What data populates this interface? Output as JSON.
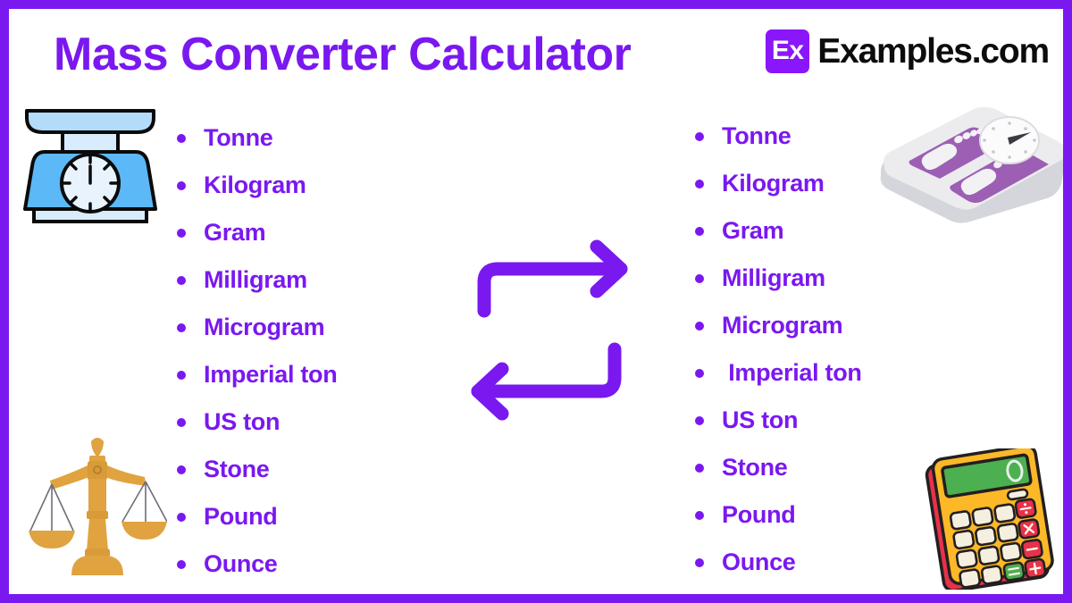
{
  "border_color": "#7a18f0",
  "background_color": "#ffffff",
  "accent_color": "#7a18f0",
  "header": {
    "title": "Mass Converter Calculator",
    "title_color": "#7a18f0",
    "brand": {
      "mark_text": "Ex",
      "mark_color": "#8a16fb",
      "name": "Examples.com",
      "name_color": "#0c0c0c"
    }
  },
  "left_column": {
    "items": [
      {
        "label": "Tonne"
      },
      {
        "label": "Kilogram"
      },
      {
        "label": "Gram"
      },
      {
        "label": "Milligram"
      },
      {
        "label": "Microgram"
      },
      {
        "label": "Imperial ton"
      },
      {
        "label": "US ton"
      },
      {
        "label": "Stone"
      },
      {
        "label": "Pound"
      },
      {
        "label": "Ounce"
      }
    ]
  },
  "right_column": {
    "items": [
      {
        "label": "Tonne"
      },
      {
        "label": "Kilogram"
      },
      {
        "label": "Gram"
      },
      {
        "label": "Milligram"
      },
      {
        "label": "Microgram"
      },
      {
        "label": " Imperial ton"
      },
      {
        "label": "US ton"
      },
      {
        "label": "Stone"
      },
      {
        "label": "Pound"
      },
      {
        "label": "Ounce"
      }
    ]
  },
  "center": {
    "arrow_color": "#7a18f0",
    "top_arrow": "arrow-right",
    "bottom_arrow": "arrow-left"
  },
  "decorations": {
    "top_left": "kitchen-scale-icon",
    "bottom_left": "balance-scale-icon",
    "top_right": "bathroom-scale-icon",
    "bottom_right": "calculator-icon",
    "calculator_display_value": "0"
  }
}
